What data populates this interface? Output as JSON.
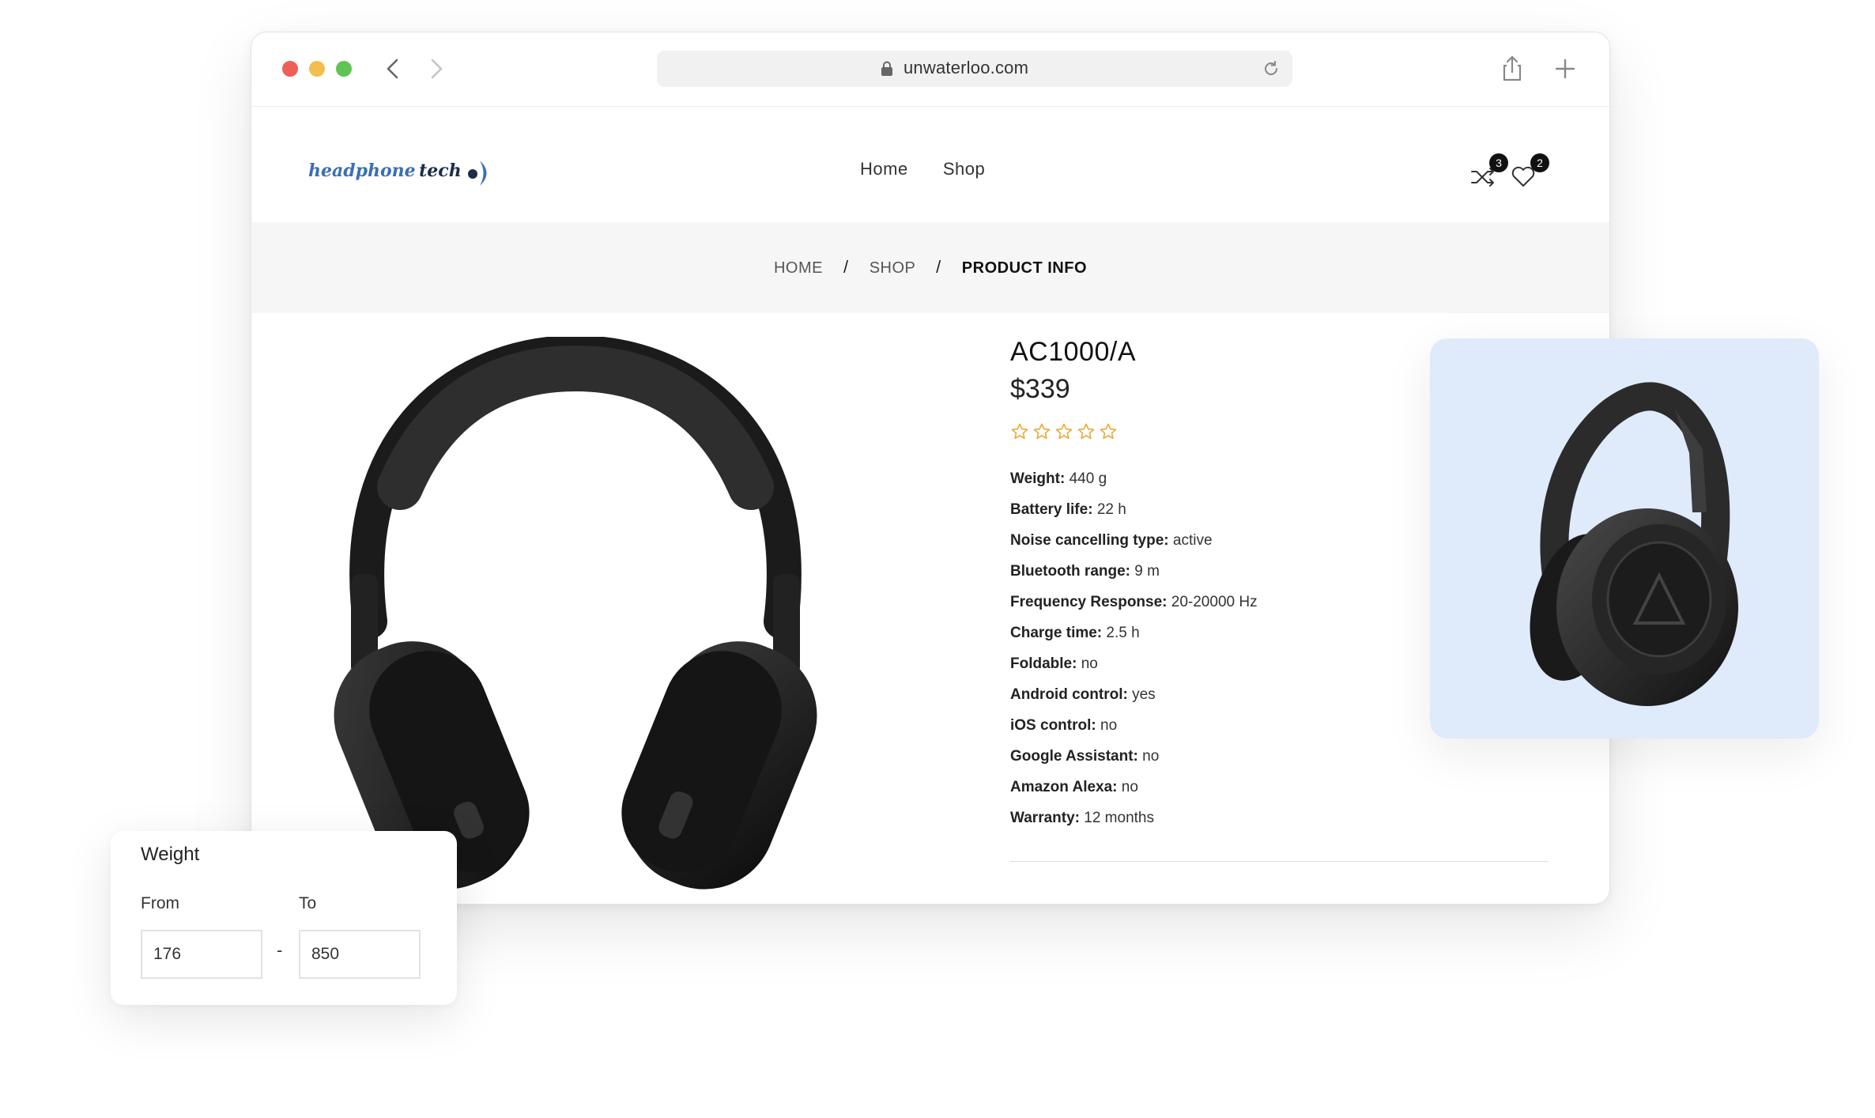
{
  "browser": {
    "url": "unwaterloo.com"
  },
  "header": {
    "logo_word1": "headphone",
    "logo_word2": "tech",
    "menu": [
      {
        "label": "Home"
      },
      {
        "label": "Shop"
      }
    ],
    "compare_count": "3",
    "wishlist_count": "2"
  },
  "breadcrumb": {
    "items": [
      {
        "label": "HOME"
      },
      {
        "label": "SHOP"
      },
      {
        "label": "PRODUCT INFO"
      }
    ],
    "separator": "/"
  },
  "product": {
    "name": "AC1000/A",
    "price": "$339",
    "rating_stars_filled": 0,
    "rating_stars_total": 5,
    "specs": [
      {
        "label": "Weight:",
        "value": "440 g"
      },
      {
        "label": "Battery life:",
        "value": "22 h"
      },
      {
        "label": "Noise cancelling type:",
        "value": "active"
      },
      {
        "label": "Bluetooth range:",
        "value": "9 m"
      },
      {
        "label": "Frequency Response:",
        "value": "20-20000 Hz"
      },
      {
        "label": "Charge time:",
        "value": "2.5 h"
      },
      {
        "label": "Foldable:",
        "value": "no"
      },
      {
        "label": "Android control:",
        "value": "yes"
      },
      {
        "label": "iOS control:",
        "value": "no"
      },
      {
        "label": "Google Assistant:",
        "value": "no"
      },
      {
        "label": "Amazon Alexa:",
        "value": "no"
      },
      {
        "label": "Warranty:",
        "value": "12 months"
      }
    ]
  },
  "filter": {
    "title": "Weight",
    "from_label": "From",
    "to_label": "To",
    "from_value": "176",
    "to_value": "850",
    "dash": "-"
  },
  "colors": {
    "star": "#e8a935",
    "side_card_bg": "#dfeafb",
    "breadcrumb_bg": "#f6f6f6"
  }
}
